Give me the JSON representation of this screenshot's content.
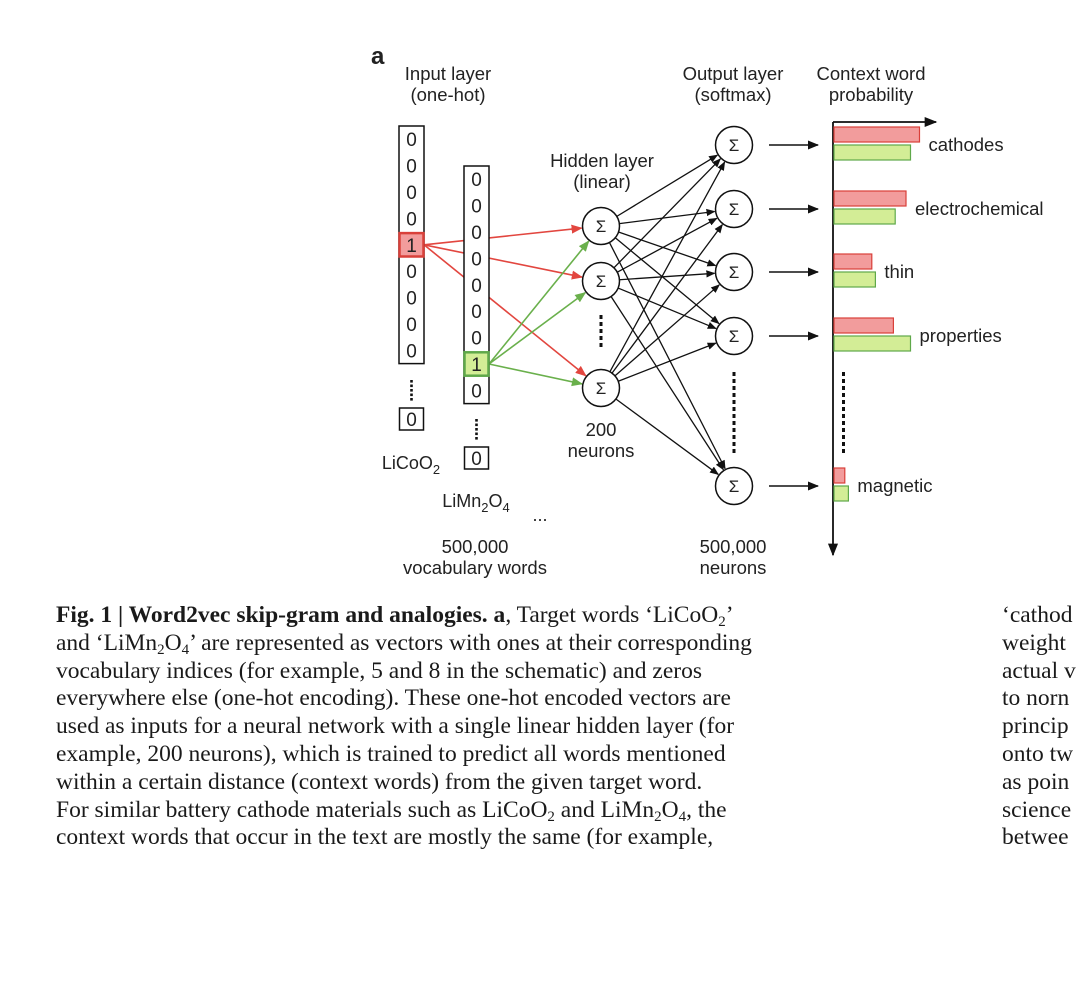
{
  "figure": {
    "panel_label": "a",
    "input_layer": {
      "title": "Input layer",
      "subtitle": "(one-hot)"
    },
    "hidden_layer": {
      "title": "Hidden layer",
      "subtitle": "(linear)",
      "count_label": "200",
      "unit_label": "neurons"
    },
    "output_layer": {
      "title": "Output layer",
      "subtitle": "(softmax)",
      "count_label": "500,000",
      "unit_label": "neurons"
    },
    "probability": {
      "title": "Context word",
      "subtitle": "probability"
    },
    "vocab": {
      "count_label": "500,000",
      "unit_label": "vocabulary words",
      "ellipsis": "..."
    },
    "node_symbol": "Σ",
    "vectors": [
      {
        "word_base": "LiCoO",
        "word_parts": [
          [
            "LiCoO",
            ""
          ],
          [
            "2",
            "sub"
          ]
        ],
        "cells": [
          "0",
          "0",
          "0",
          "0",
          "1",
          "0",
          "0",
          "0",
          "0"
        ],
        "hot_index": 4,
        "last_cell": "0",
        "color": "red"
      },
      {
        "word_parts": [
          [
            "LiMn",
            ""
          ],
          [
            "2",
            "sub"
          ],
          [
            "O",
            ""
          ],
          [
            "4",
            "sub"
          ]
        ],
        "cells": [
          "0",
          "0",
          "0",
          "0",
          "0",
          "0",
          "0",
          "1",
          "0"
        ],
        "hot_index": 7,
        "last_cell": "0",
        "color": "green"
      }
    ],
    "colors": {
      "red_fill": "#f29c9c",
      "red_stroke": "#d9403a",
      "green_fill": "#d3ed96",
      "green_stroke": "#5fa84a",
      "red_line": "#e2463f",
      "green_line": "#6ab04c",
      "ink": "#111111"
    }
  },
  "chart_data": {
    "type": "bar",
    "orientation": "horizontal",
    "title": "Context word probability",
    "categories": [
      "cathodes",
      "electrochemical",
      "thin",
      "properties",
      "magnetic"
    ],
    "series": [
      {
        "name": "LiCoO2",
        "color": "#f29c9c",
        "values": [
          0.95,
          0.8,
          0.42,
          0.66,
          0.12
        ]
      },
      {
        "name": "LiMn2O4",
        "color": "#d3ed96",
        "values": [
          0.85,
          0.68,
          0.46,
          0.85,
          0.16
        ]
      }
    ],
    "xlim": [
      0,
      1
    ],
    "axis_ticks": false,
    "ellipsis_between": [
      "properties",
      "magnetic"
    ]
  },
  "caption": {
    "left_lines": [
      [
        [
          "Fig. 1 | Word2vec skip-gram and analogies. a",
          "b"
        ],
        [
          ", Target words ‘LiCoO",
          ""
        ],
        [
          "2",
          "sub"
        ],
        [
          "’",
          ""
        ]
      ],
      [
        [
          "and ‘LiMn",
          ""
        ],
        [
          "2",
          "sub"
        ],
        [
          "O",
          ""
        ],
        [
          "4",
          "sub"
        ],
        [
          "’ are represented as vectors with ones at their corresponding",
          ""
        ]
      ],
      [
        [
          "vocabulary indices (for example, 5 and 8 in the schematic) and zeros",
          ""
        ]
      ],
      [
        [
          "everywhere else (one-hot encoding). These one-hot encoded vectors are",
          ""
        ]
      ],
      [
        [
          "used as inputs for a neural network with a single linear hidden layer (for",
          ""
        ]
      ],
      [
        [
          "example, 200 neurons), which is trained to predict all words mentioned",
          ""
        ]
      ],
      [
        [
          "within a certain distance (context words) from the given target word.",
          ""
        ]
      ],
      [
        [
          "For similar battery cathode materials such as LiCoO",
          ""
        ],
        [
          "2",
          "sub"
        ],
        [
          " and LiMn",
          ""
        ],
        [
          "2",
          "sub"
        ],
        [
          "O",
          ""
        ],
        [
          "4",
          "sub"
        ],
        [
          ", the",
          ""
        ]
      ],
      [
        [
          "context words that occur in the text are mostly the same (for example,",
          ""
        ]
      ]
    ],
    "right_lines": [
      "‘cathod",
      "weight",
      "actual v",
      "to norn",
      "princip",
      "onto tw",
      "as poin",
      "science",
      "betwee"
    ]
  }
}
